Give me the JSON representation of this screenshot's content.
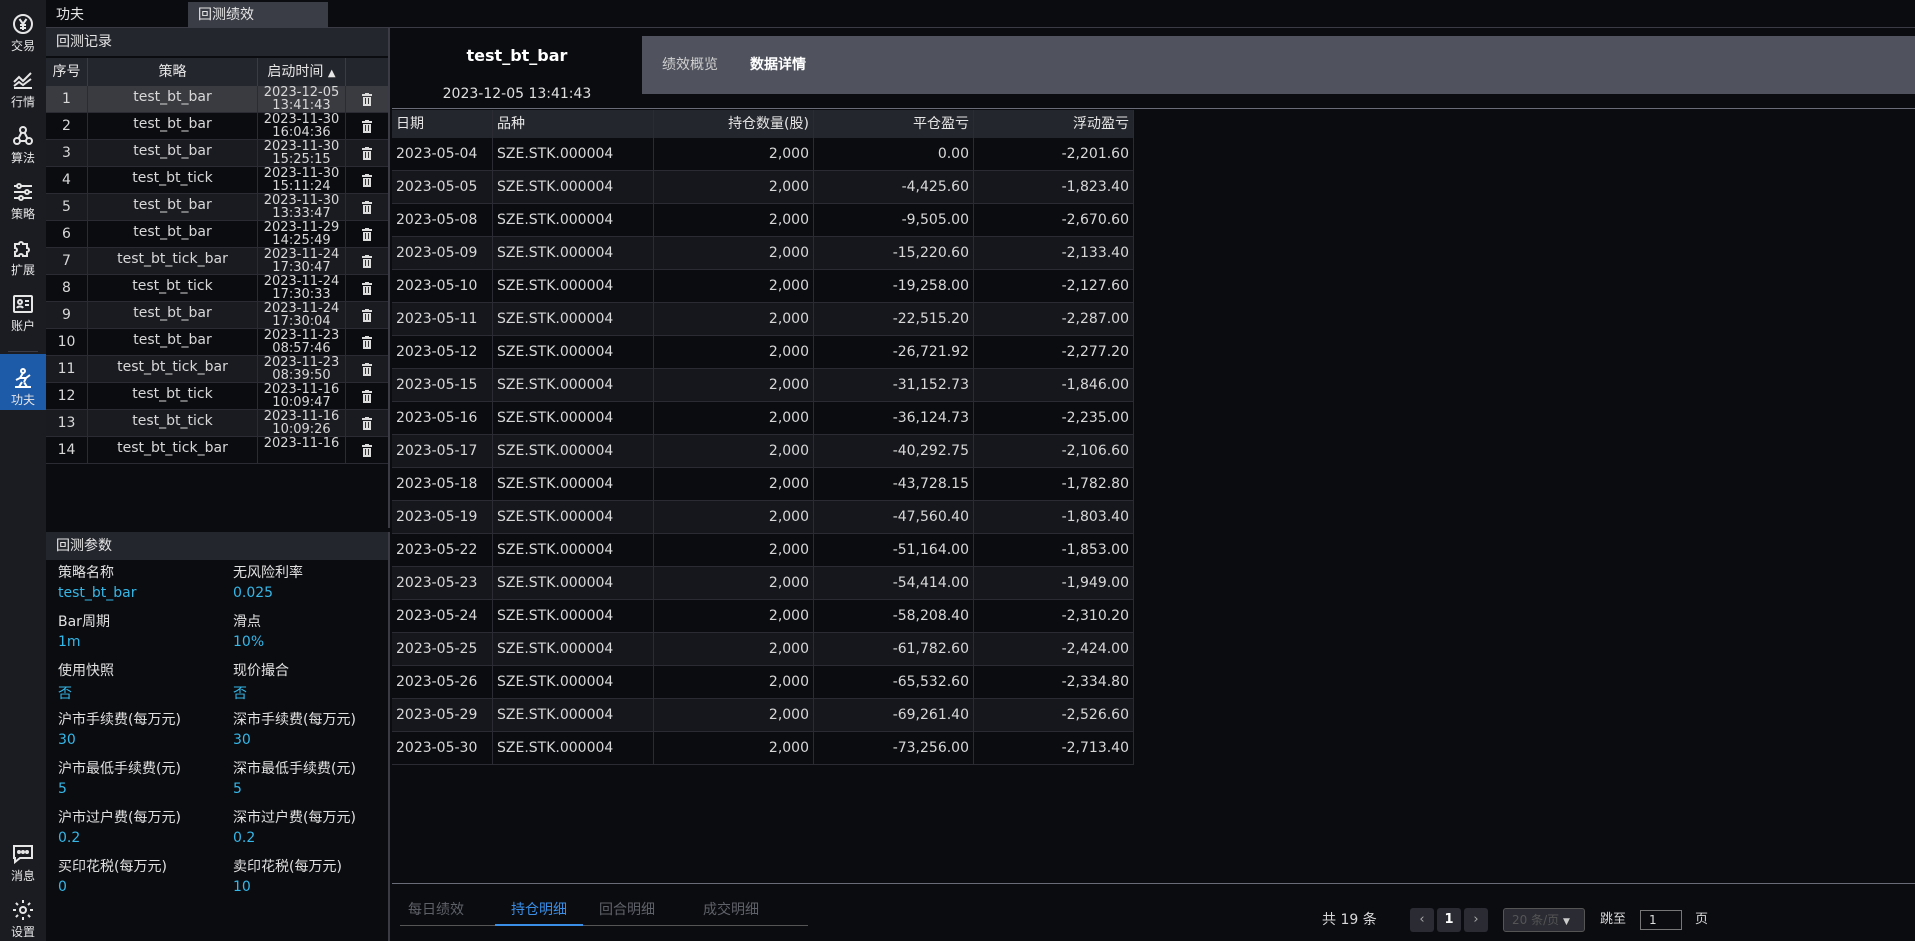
{
  "nav": {
    "items": [
      {
        "label": "交易",
        "icon": "yen-circle-icon"
      },
      {
        "label": "行情",
        "icon": "chart-line-icon"
      },
      {
        "label": "算法",
        "icon": "nodes-icon"
      },
      {
        "label": "策略",
        "icon": "sliders-icon"
      },
      {
        "label": "扩展",
        "icon": "puzzle-icon"
      },
      {
        "label": "账户",
        "icon": "id-card-icon"
      },
      {
        "label": "功夫",
        "icon": "kungfu-icon"
      }
    ],
    "bottom": [
      {
        "label": "消息",
        "icon": "message-icon"
      },
      {
        "label": "设置",
        "icon": "gear-icon"
      }
    ]
  },
  "top_tabs": [
    "功夫",
    "回测绩效"
  ],
  "records": {
    "title": "回测记录",
    "headers": [
      "序号",
      "策略",
      "启动时间"
    ],
    "rows": [
      {
        "no": "1",
        "strategy": "test_bt_bar",
        "date": "2023-12-05",
        "time": "13:41:43"
      },
      {
        "no": "2",
        "strategy": "test_bt_bar",
        "date": "2023-11-30",
        "time": "16:04:36"
      },
      {
        "no": "3",
        "strategy": "test_bt_bar",
        "date": "2023-11-30",
        "time": "15:25:15"
      },
      {
        "no": "4",
        "strategy": "test_bt_tick",
        "date": "2023-11-30",
        "time": "15:11:24"
      },
      {
        "no": "5",
        "strategy": "test_bt_bar",
        "date": "2023-11-30",
        "time": "13:33:47"
      },
      {
        "no": "6",
        "strategy": "test_bt_bar",
        "date": "2023-11-29",
        "time": "14:25:49"
      },
      {
        "no": "7",
        "strategy": "test_bt_tick_bar",
        "date": "2023-11-24",
        "time": "17:30:47"
      },
      {
        "no": "8",
        "strategy": "test_bt_tick",
        "date": "2023-11-24",
        "time": "17:30:33"
      },
      {
        "no": "9",
        "strategy": "test_bt_bar",
        "date": "2023-11-24",
        "time": "17:30:04"
      },
      {
        "no": "10",
        "strategy": "test_bt_bar",
        "date": "2023-11-23",
        "time": "08:57:46"
      },
      {
        "no": "11",
        "strategy": "test_bt_tick_bar",
        "date": "2023-11-23",
        "time": "08:39:50"
      },
      {
        "no": "12",
        "strategy": "test_bt_tick",
        "date": "2023-11-16",
        "time": "10:09:47"
      },
      {
        "no": "13",
        "strategy": "test_bt_tick",
        "date": "2023-11-16",
        "time": "10:09:26"
      },
      {
        "no": "14",
        "strategy": "test_bt_tick_bar",
        "date": "2023-11-16",
        "time": ""
      }
    ]
  },
  "params": {
    "title": "回测参数",
    "items": [
      {
        "label": "策略名称",
        "value": "test_bt_bar"
      },
      {
        "label": "无风险利率",
        "value": "0.025"
      },
      {
        "label": "Bar周期",
        "value": "1m"
      },
      {
        "label": "滑点",
        "value": "10%"
      },
      {
        "label": "使用快照",
        "value": "否"
      },
      {
        "label": "现价撮合",
        "value": "否"
      },
      {
        "label": "沪市手续费(每万元)",
        "value": "30"
      },
      {
        "label": "深市手续费(每万元)",
        "value": "30"
      },
      {
        "label": "沪市最低手续费(元)",
        "value": "5"
      },
      {
        "label": "深市最低手续费(元)",
        "value": "5"
      },
      {
        "label": "沪市过户费(每万元)",
        "value": "0.2"
      },
      {
        "label": "深市过户费(每万元)",
        "value": "0.2"
      },
      {
        "label": "买印花税(每万元)",
        "value": "0"
      },
      {
        "label": "卖印花税(每万元)",
        "value": "10"
      }
    ]
  },
  "main": {
    "title": "test_bt_bar",
    "datetime": "2023-12-05 13:41:43",
    "tabs": [
      "绩效概览",
      "数据详情"
    ],
    "grid": {
      "headers": [
        "日期",
        "品种",
        "持仓数量(股)",
        "平仓盈亏",
        "浮动盈亏"
      ],
      "rows": [
        [
          "2023-05-04",
          "SZE.STK.000004",
          "2,000",
          "0.00",
          "-2,201.60"
        ],
        [
          "2023-05-05",
          "SZE.STK.000004",
          "2,000",
          "-4,425.60",
          "-1,823.40"
        ],
        [
          "2023-05-08",
          "SZE.STK.000004",
          "2,000",
          "-9,505.00",
          "-2,670.60"
        ],
        [
          "2023-05-09",
          "SZE.STK.000004",
          "2,000",
          "-15,220.60",
          "-2,133.40"
        ],
        [
          "2023-05-10",
          "SZE.STK.000004",
          "2,000",
          "-19,258.00",
          "-2,127.60"
        ],
        [
          "2023-05-11",
          "SZE.STK.000004",
          "2,000",
          "-22,515.20",
          "-2,287.00"
        ],
        [
          "2023-05-12",
          "SZE.STK.000004",
          "2,000",
          "-26,721.92",
          "-2,277.20"
        ],
        [
          "2023-05-15",
          "SZE.STK.000004",
          "2,000",
          "-31,152.73",
          "-1,846.00"
        ],
        [
          "2023-05-16",
          "SZE.STK.000004",
          "2,000",
          "-36,124.73",
          "-2,235.00"
        ],
        [
          "2023-05-17",
          "SZE.STK.000004",
          "2,000",
          "-40,292.75",
          "-2,106.60"
        ],
        [
          "2023-05-18",
          "SZE.STK.000004",
          "2,000",
          "-43,728.15",
          "-1,782.80"
        ],
        [
          "2023-05-19",
          "SZE.STK.000004",
          "2,000",
          "-47,560.40",
          "-1,803.40"
        ],
        [
          "2023-05-22",
          "SZE.STK.000004",
          "2,000",
          "-51,164.00",
          "-1,853.00"
        ],
        [
          "2023-05-23",
          "SZE.STK.000004",
          "2,000",
          "-54,414.00",
          "-1,949.00"
        ],
        [
          "2023-05-24",
          "SZE.STK.000004",
          "2,000",
          "-58,208.40",
          "-2,310.20"
        ],
        [
          "2023-05-25",
          "SZE.STK.000004",
          "2,000",
          "-61,782.60",
          "-2,424.00"
        ],
        [
          "2023-05-26",
          "SZE.STK.000004",
          "2,000",
          "-65,532.60",
          "-2,334.80"
        ],
        [
          "2023-05-29",
          "SZE.STK.000004",
          "2,000",
          "-69,261.40",
          "-2,526.60"
        ],
        [
          "2023-05-30",
          "SZE.STK.000004",
          "2,000",
          "-73,256.00",
          "-2,713.40"
        ]
      ]
    },
    "bottom_tabs": [
      "每日绩效",
      "持仓明细",
      "回合明细",
      "成交明细"
    ],
    "pager": {
      "total": "共 19 条",
      "page": "1",
      "page_size": "20 条/页",
      "goto": "跳至",
      "goto_value": "1",
      "suffix": "页"
    }
  },
  "colors": {
    "accent": "#1d5aa8",
    "param_value": "#35b7e8",
    "active_tab": "#3a8ee6"
  }
}
